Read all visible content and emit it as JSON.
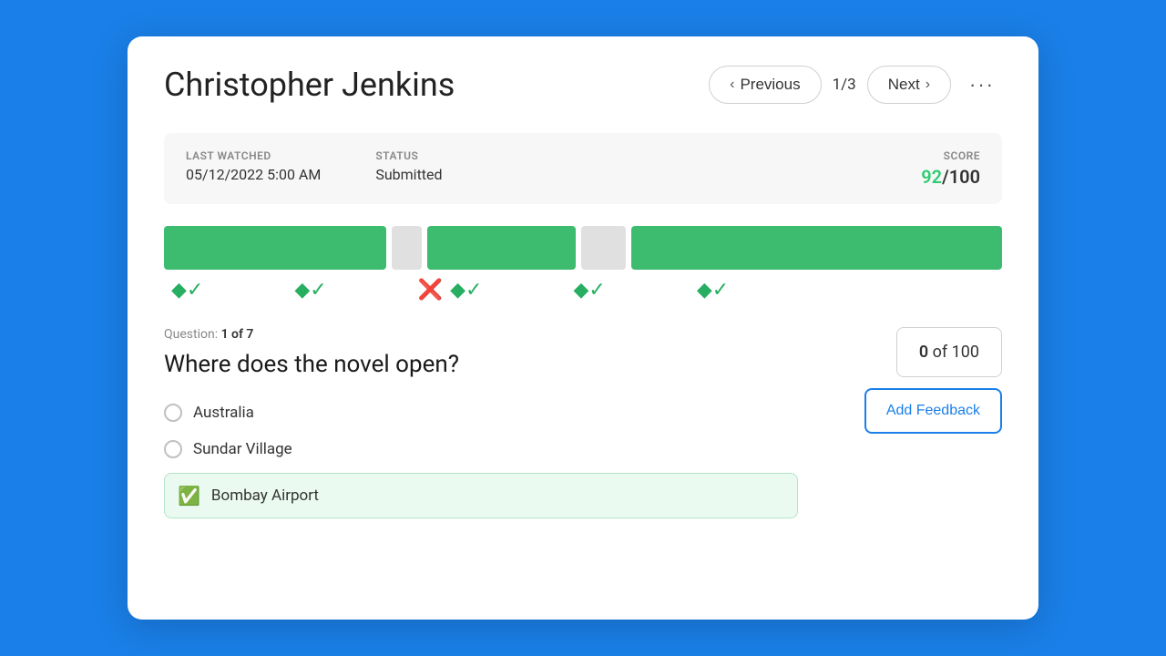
{
  "header": {
    "title": "Christopher Jenkins",
    "prev_label": "Previous",
    "next_label": "Next",
    "page_indicator": "1/3",
    "more_icon": "···"
  },
  "info_bar": {
    "last_watched_label": "LAST WATCHED",
    "last_watched_value": "05/12/2022  5:00 AM",
    "status_label": "STATUS",
    "status_value": "Submitted",
    "score_label": "SCORE",
    "score_highlight": "92",
    "score_total": "/100"
  },
  "progress": {
    "segments": [
      {
        "type": "green",
        "flex": 3
      },
      {
        "type": "gray",
        "flex": 0.5
      },
      {
        "type": "green",
        "flex": 2
      },
      {
        "type": "gray",
        "flex": 0.8
      },
      {
        "type": "green",
        "flex": 5
      }
    ],
    "icons": [
      {
        "type": "check"
      },
      {
        "type": "check"
      },
      {
        "type": "cross"
      },
      {
        "type": "check"
      },
      {
        "type": "check"
      },
      {
        "type": "check"
      }
    ]
  },
  "question": {
    "meta_prefix": "Question: ",
    "meta_number": "1 of 7",
    "text": "Where does the novel open?",
    "score_label": "0 of 100",
    "feedback_label": "Add Feedback",
    "options": [
      {
        "label": "Australia",
        "correct": false
      },
      {
        "label": "Sundar Village",
        "correct": false
      },
      {
        "label": "Bombay Airport",
        "correct": true
      }
    ]
  }
}
